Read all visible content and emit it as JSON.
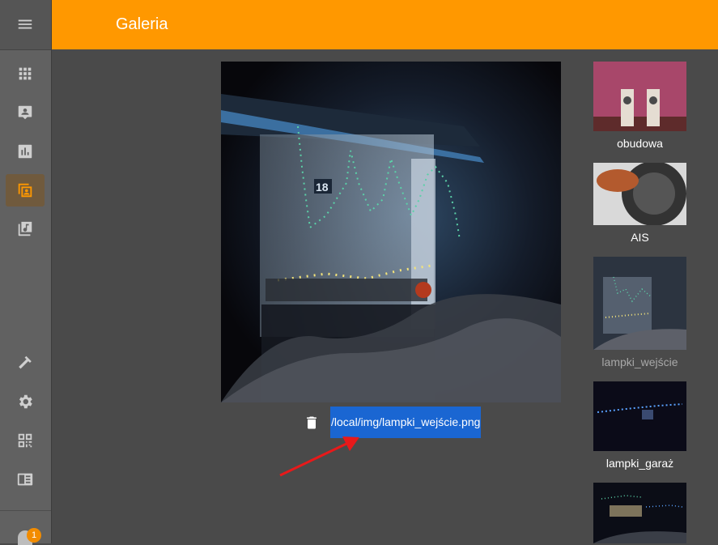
{
  "header": {
    "title": "Galeria"
  },
  "sidebar": {
    "items": [
      {
        "name": "dashboard",
        "icon": "apps-grid-icon",
        "active": false
      },
      {
        "name": "devices",
        "icon": "account-box-icon",
        "active": false
      },
      {
        "name": "charts",
        "icon": "bar-chart-icon",
        "active": false
      },
      {
        "name": "gallery",
        "icon": "image-person-icon",
        "active": true
      },
      {
        "name": "music",
        "icon": "music-library-icon",
        "active": false
      },
      {
        "name": "tools",
        "icon": "hammer-icon",
        "active": false
      },
      {
        "name": "settings",
        "icon": "gear-icon",
        "active": false
      },
      {
        "name": "qr",
        "icon": "qr-code-icon",
        "active": false
      },
      {
        "name": "panel",
        "icon": "panel-icon",
        "active": false
      }
    ],
    "notification_count": "1"
  },
  "viewer": {
    "image_number": "18",
    "path": "/local/img/lampki_wejście.png"
  },
  "thumbnails": [
    {
      "label": "obudowa",
      "selected": false
    },
    {
      "label": "AIS",
      "selected": false
    },
    {
      "label": "lampki_wejście",
      "selected": true
    },
    {
      "label": "lampki_garaż",
      "selected": false
    },
    {
      "label": "",
      "selected": false
    }
  ],
  "colors": {
    "accent": "#ff9800",
    "selection": "#1a66d2",
    "arrow": "#e8191a"
  }
}
